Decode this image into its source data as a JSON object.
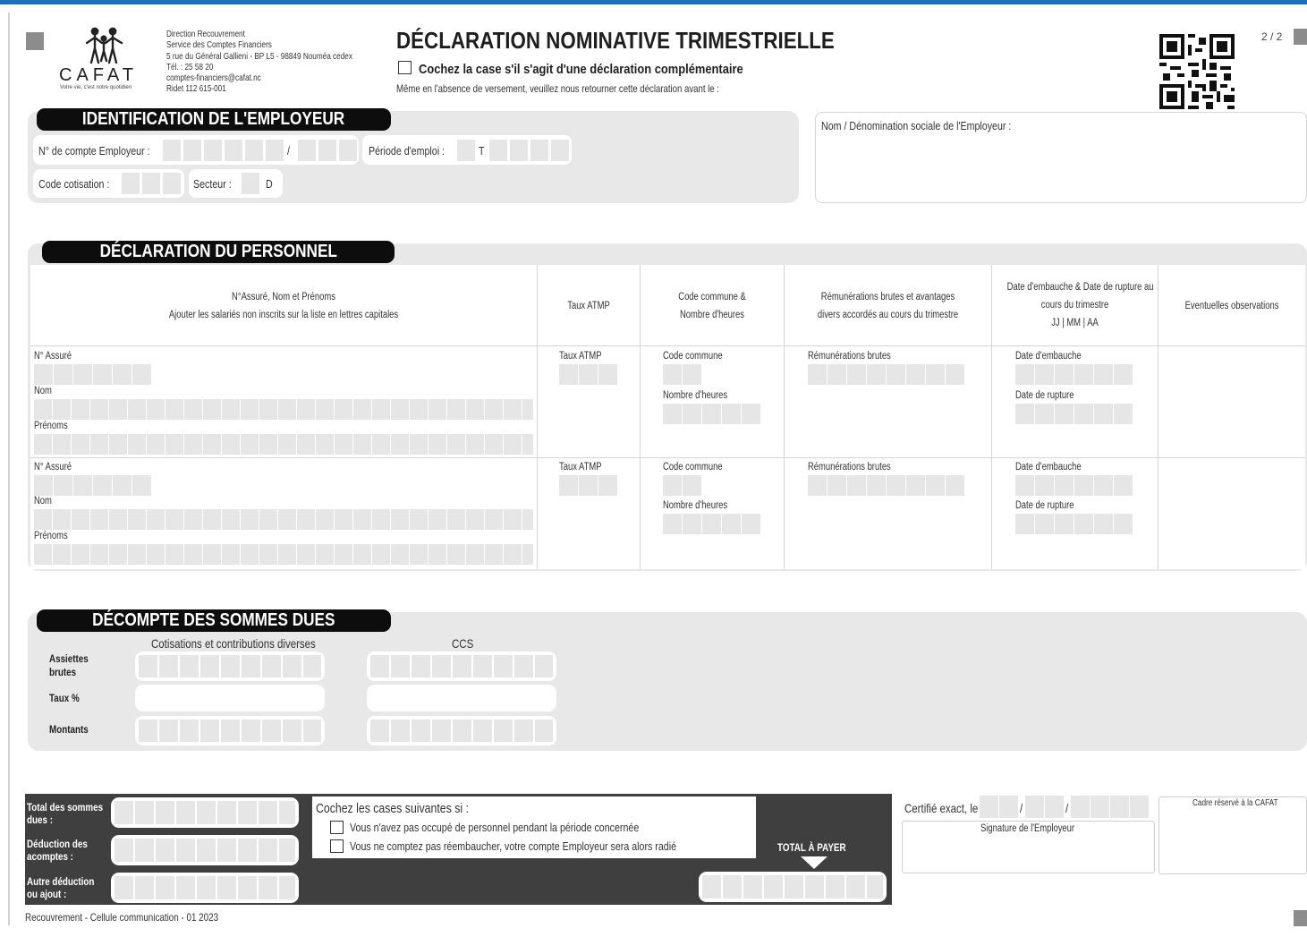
{
  "header": {
    "logo_text": "CAFAT",
    "logo_tagline": "Votre vie, c'est notre quotidien",
    "address_lines": [
      "Direction Recouvrement",
      "Service des Comptes Financiers",
      "5 rue du Général Gallieni - BP L5 - 98849 Nouméa cedex",
      "Tél. : 25 58 20",
      "comptes-financiers@cafat.nc",
      "Ridet 112 615-001"
    ],
    "title": "DÉCLARATION NOMINATIVE TRIMESTRIELLE",
    "complementary_checkbox_label": "Cochez la case s'il s'agit d'une déclaration complémentaire",
    "deadline_text": "Même en l'absence de versement, veuillez nous retourner cette déclaration avant le :",
    "page_number": "2 / 2"
  },
  "employer": {
    "section_title": "IDENTIFICATION DE L'EMPLOYEUR",
    "account_label": "N° de compte Employeur :",
    "account_sep": "/",
    "period_label": "Période d'emploi :",
    "period_prefix": "T",
    "code_label": "Code cotisation :",
    "sector_label": "Secteur :",
    "sector_value": "D",
    "name_label": "Nom / Dénomination sociale de l'Employeur :"
  },
  "personnel": {
    "section_title": "DÉCLARATION DU PERSONNEL",
    "columns": {
      "c1_line1": "N°Assuré, Nom et Prénoms",
      "c1_line2": "Ajouter les salariés non inscrits sur la liste en lettres capitales",
      "c2": "Taux ATMP",
      "c3_line1": "Code commune &",
      "c3_line2": "Nombre d'heures",
      "c4_line1": "Rémunérations brutes et avantages",
      "c4_line2": "divers accordés au cours du trimestre",
      "c5_line1": "Date d'embauche & Date de rupture au",
      "c5_line2": "cours du trimestre",
      "c5_line3": "JJ  |  MM  |  AA",
      "c6": "Eventuelles observations"
    },
    "row_labels": {
      "insured": "N° Assuré",
      "name": "Nom",
      "firstnames": "Prénoms",
      "rate": "Taux ATMP",
      "commune": "Code commune",
      "hours": "Nombre d'heures",
      "pay": "Rémunérations brutes",
      "hire": "Date d'embauche",
      "end": "Date de rupture"
    }
  },
  "sums": {
    "section_title": "DÉCOMPTE DES SOMMES DUES",
    "col1": "Cotisations et contributions diverses",
    "col2": "CCS",
    "row1_l1": "Assiettes",
    "row1_l2": "brutes",
    "row2": "Taux %",
    "row3": "Montants"
  },
  "footer": {
    "total_l1": "Total des sommes",
    "total_l2": "dues :",
    "deduction_l1": "Déduction des",
    "deduction_l2": "acomptes :",
    "other_l1": "Autre déduction",
    "other_l2": "ou ajout :",
    "check_title": "Cochez les cases suivantes si :",
    "check1": "Vous n'avez pas occupé de personnel pendant la période concernée",
    "check2": "Vous ne comptez pas réembaucher, votre compte Employeur sera alors radié",
    "total_to_pay": "TOTAL À PAYER",
    "certified": "Certifié exact, le",
    "date_sep": "/",
    "signature": "Signature de l'Employeur",
    "reserved": "Cadre réservé à la CAFAT",
    "credit": "Recouvrement - Cellule communication - 01 2023"
  },
  "colors": {
    "accent": "#1f6fb8",
    "panel": "#e8e8e8",
    "dark": "#3f3f3f"
  }
}
